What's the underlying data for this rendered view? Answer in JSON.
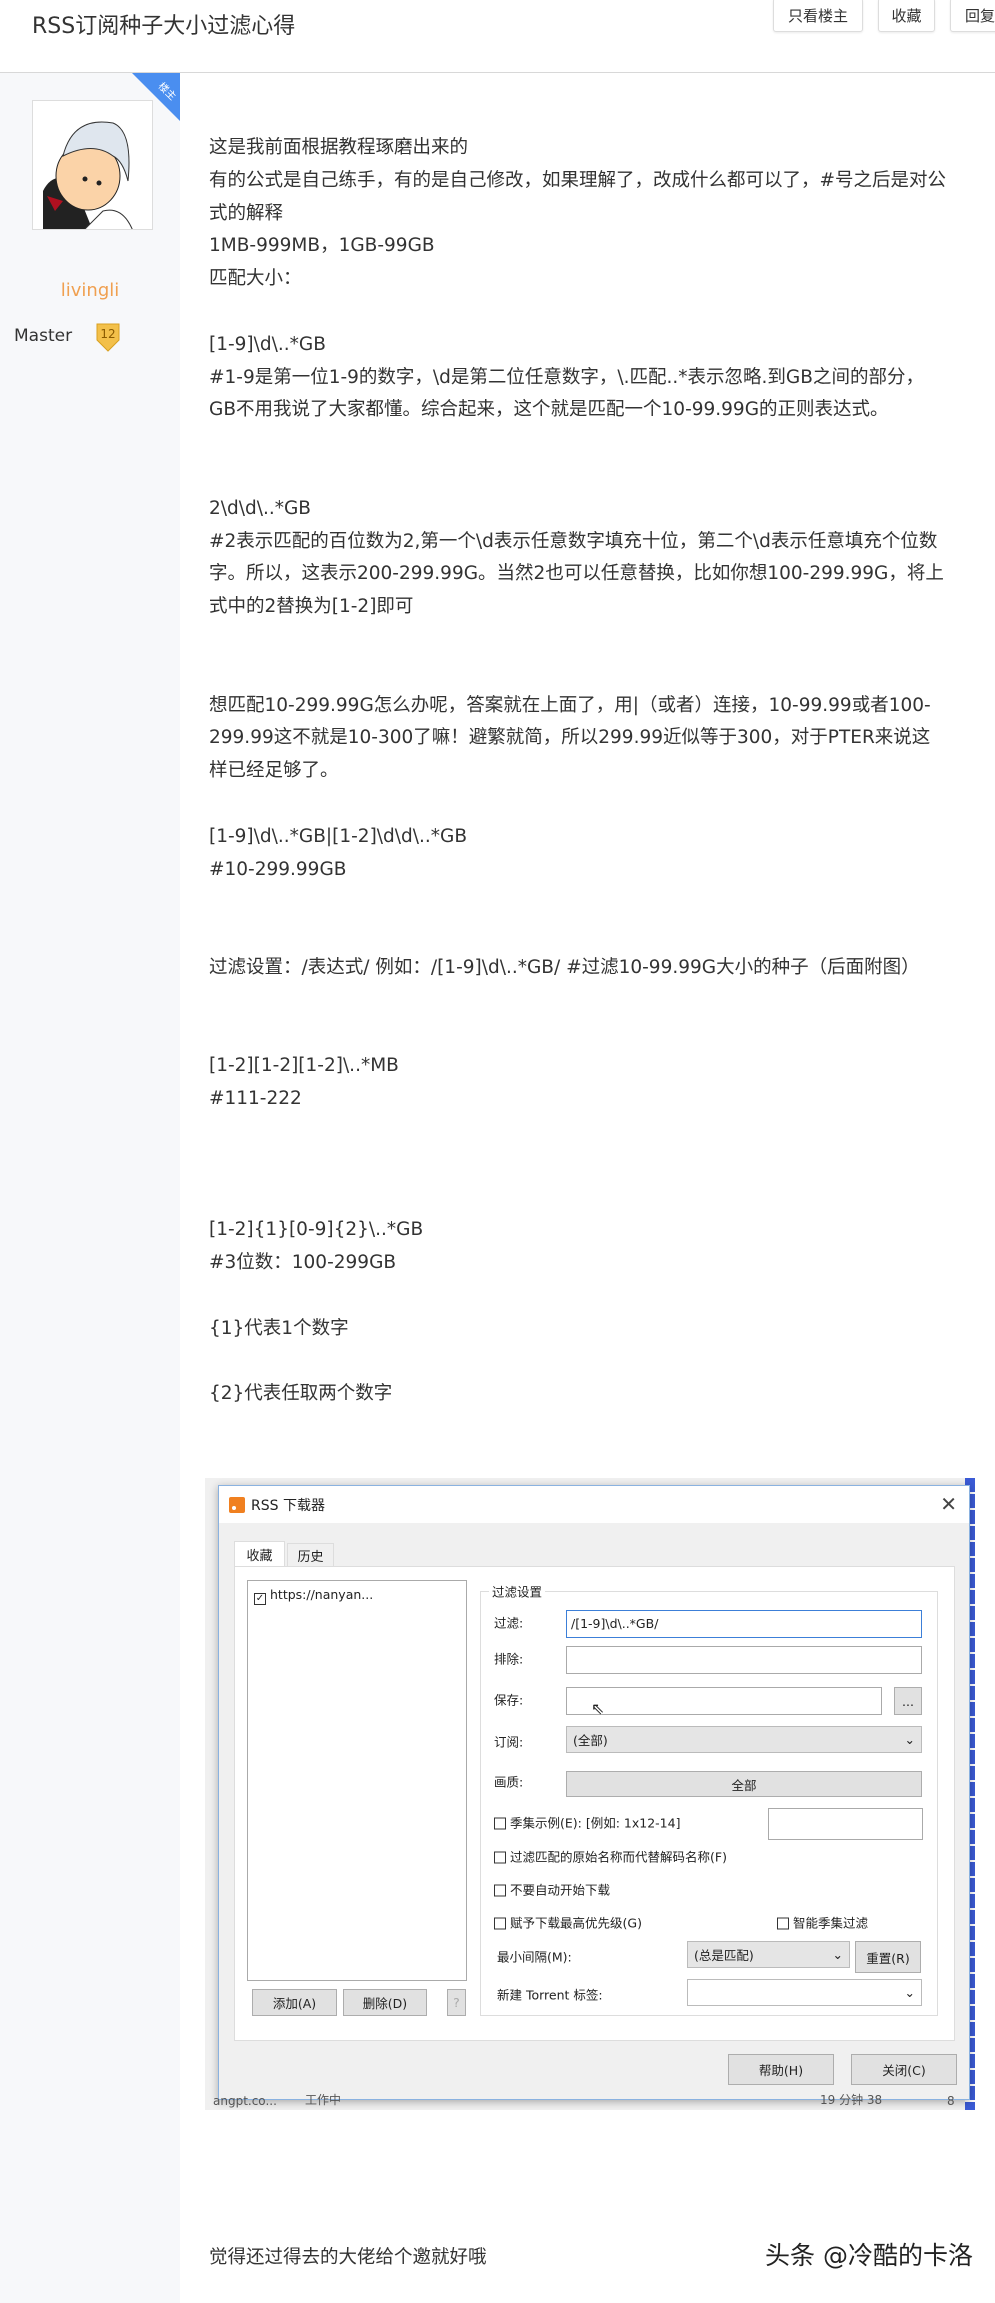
{
  "header": {
    "title": "RSS订阅种子大小过滤心得",
    "buttons": [
      "只看楼主",
      "收藏",
      "回复"
    ]
  },
  "author": {
    "badge": "楼主",
    "name": "livingli",
    "rank": "Master",
    "level": "12"
  },
  "post": {
    "lines": [
      "这是我前面根据教程琢磨出来的",
      "有的公式是自己练手，有的是自己修改，如果理解了，改成什么都可以了，#号之后是对公",
      "式的解释",
      "1MB-999MB，1GB-99GB",
      "匹配大小：",
      "",
      "[1-9]\\d\\..*GB",
      "#1-9是第一位1-9的数字，\\d是第二位任意数字，\\.匹配..*表示忽略.到GB之间的部分，",
      "GB不用我说了大家都懂。综合起来，这个就是匹配一个10-99.99G的正则表达式。",
      "",
      "",
      "2\\d\\d\\..*GB",
      "#2表示匹配的百位数为2,第一个\\d表示任意数字填充十位，第二个\\d表示任意填充个位数",
      "字。所以，这表示200-299.99G。当然2也可以任意替换，比如你想100-299.99G，将上",
      "式中的2替换为[1-2]即可",
      "",
      "",
      "想匹配10-299.99G怎么办呢，答案就在上面了，用|（或者）连接，10-99.99或者100-",
      "299.99这不就是10-300了嘛！避繁就简，所以299.99近似等于300，对于PTER来说这",
      "样已经足够了。",
      "",
      "[1-9]\\d\\..*GB|[1-2]\\d\\d\\..*GB",
      "#10-299.99GB",
      "",
      "",
      "过滤设置：/表达式/ 例如：/[1-9]\\d\\..*GB/ #过滤10-99.99G大小的种子（后面附图）",
      "",
      "",
      "[1-2][1-2][1-2]\\..*MB",
      "#111-222",
      "",
      "",
      "",
      "[1-2]{1}[0-9]{2}\\..*GB",
      "#3位数：100-299GB",
      "",
      "{1}代表1个数字",
      "",
      "{2}代表任取两个数字"
    ],
    "footer": "觉得还过得去的大佬给个邀就好哦"
  },
  "screenshot": {
    "window_title": "RSS 下载器",
    "tabs": [
      "收藏",
      "历史"
    ],
    "feed_item": "https://nanyan...",
    "add": "添加(A)",
    "delete": "删除(D)",
    "help_q": "?",
    "group_title": "过滤设置",
    "filter_label": "过滤:",
    "filter_value": "/[1-9]\\d\\..*GB/",
    "exclude_label": "排除:",
    "save_label": "保存:",
    "browse": "...",
    "sub_label": "订阅:",
    "sub_value": "(全部)",
    "quality_label": "画质:",
    "quality_value": "全部",
    "cb1": "季集示例(E): [例如: 1x12-14]",
    "cb2": "过滤匹配的原始名称而代替解码名称(F)",
    "cb3": "不要自动开始下载",
    "cb4": "赋予下载最高优先级(G)",
    "cb5": "智能季集过滤",
    "min_label": "最小间隔(M):",
    "min_value": "(总是匹配)",
    "reset": "重置(R)",
    "tag_label": "新建 Torrent 标签:",
    "help": "帮助(H)",
    "close": "关闭(C)",
    "bg_texts": [
      "angpt.co...",
      "工作中",
      "19 分钟 38",
      "8"
    ]
  },
  "watermark": "头条 @冷酷的卡洛"
}
